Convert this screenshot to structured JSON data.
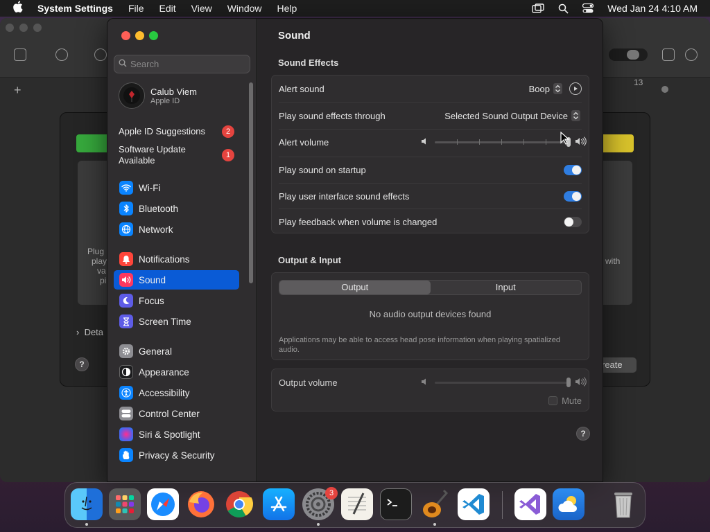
{
  "menubar": {
    "app_name": "System Settings",
    "items": [
      "File",
      "Edit",
      "View",
      "Window",
      "Help"
    ],
    "clock": "Wed Jan 24  4:10 AM"
  },
  "background_window": {
    "ruler_number": "13",
    "left_text": [
      "Plug",
      "play",
      "va",
      "pi"
    ],
    "details_label": "Deta",
    "right_text": "with",
    "create_label": "reate"
  },
  "sidebar": {
    "search_placeholder": "Search",
    "account": {
      "name": "Calub Viem",
      "subtitle": "Apple ID"
    },
    "notices": [
      {
        "label": "Apple ID Suggestions",
        "badge": "2"
      },
      {
        "label": "Software Update Available",
        "badge": "1"
      }
    ],
    "items": [
      {
        "label": "Wi-Fi",
        "icon": "wifi-icon",
        "color": "#0a84ff"
      },
      {
        "label": "Bluetooth",
        "icon": "bluetooth-icon",
        "color": "#0a84ff"
      },
      {
        "label": "Network",
        "icon": "globe-icon",
        "color": "#0a84ff"
      },
      {
        "label": "Notifications",
        "icon": "bell-icon",
        "color": "#ff453a"
      },
      {
        "label": "Sound",
        "icon": "speaker-icon",
        "color": "#ff375f",
        "selected": true
      },
      {
        "label": "Focus",
        "icon": "moon-icon",
        "color": "#5e5ce6"
      },
      {
        "label": "Screen Time",
        "icon": "hourglass-icon",
        "color": "#5e5ce6"
      },
      {
        "label": "General",
        "icon": "gear-icon",
        "color": "#8e8e93"
      },
      {
        "label": "Appearance",
        "icon": "appearance-icon",
        "color": "#1c1c1e"
      },
      {
        "label": "Accessibility",
        "icon": "accessibility-icon",
        "color": "#0a84ff"
      },
      {
        "label": "Control Center",
        "icon": "control-center-icon",
        "color": "#8e8e93"
      },
      {
        "label": "Siri & Spotlight",
        "icon": "siri-icon",
        "color": "#bf5af2"
      },
      {
        "label": "Privacy & Security",
        "icon": "hand-icon",
        "color": "#0a84ff"
      }
    ]
  },
  "content": {
    "title": "Sound",
    "sound_effects": {
      "heading": "Sound Effects",
      "alert_sound_label": "Alert sound",
      "alert_sound_value": "Boop",
      "play_through_label": "Play sound effects through",
      "play_through_value": "Selected Sound Output Device",
      "alert_volume_label": "Alert volume",
      "alert_volume_level": 1.0,
      "startup_label": "Play sound on startup",
      "startup_on": true,
      "ui_sounds_label": "Play user interface sound effects",
      "ui_sounds_on": true,
      "feedback_label": "Play feedback when volume is changed",
      "feedback_on": false
    },
    "output_input": {
      "heading": "Output & Input",
      "tabs": [
        "Output",
        "Input"
      ],
      "active_tab": "Output",
      "empty_message": "No audio output devices found",
      "footnote": "Applications may be able to access head pose information when playing spatialized audio."
    },
    "output_volume": {
      "label": "Output volume",
      "level": 1.0,
      "mute_label": "Mute",
      "muted": false
    },
    "help_label": "?"
  },
  "dock": {
    "apps": [
      {
        "name": "Finder",
        "icon": "finder-icon",
        "running": true
      },
      {
        "name": "Launchpad",
        "icon": "launchpad-icon"
      },
      {
        "name": "Safari",
        "icon": "safari-icon"
      },
      {
        "name": "Firefox",
        "icon": "firefox-icon"
      },
      {
        "name": "Chrome",
        "icon": "chrome-icon"
      },
      {
        "name": "App Store",
        "icon": "app-store-icon"
      },
      {
        "name": "System Settings",
        "icon": "system-settings-icon",
        "running": true,
        "badge": "3"
      },
      {
        "name": "TextEdit",
        "icon": "textedit-icon"
      },
      {
        "name": "Terminal",
        "icon": "terminal-icon"
      },
      {
        "name": "GarageBand",
        "icon": "garageband-icon",
        "running": true
      },
      {
        "name": "Visual Studio Code",
        "icon": "vscode-icon"
      },
      {
        "name": "Visual Studio",
        "icon": "visual-studio-icon"
      },
      {
        "name": "Weather",
        "icon": "weather-icon"
      },
      {
        "name": "Trash",
        "icon": "trash-icon"
      }
    ]
  }
}
